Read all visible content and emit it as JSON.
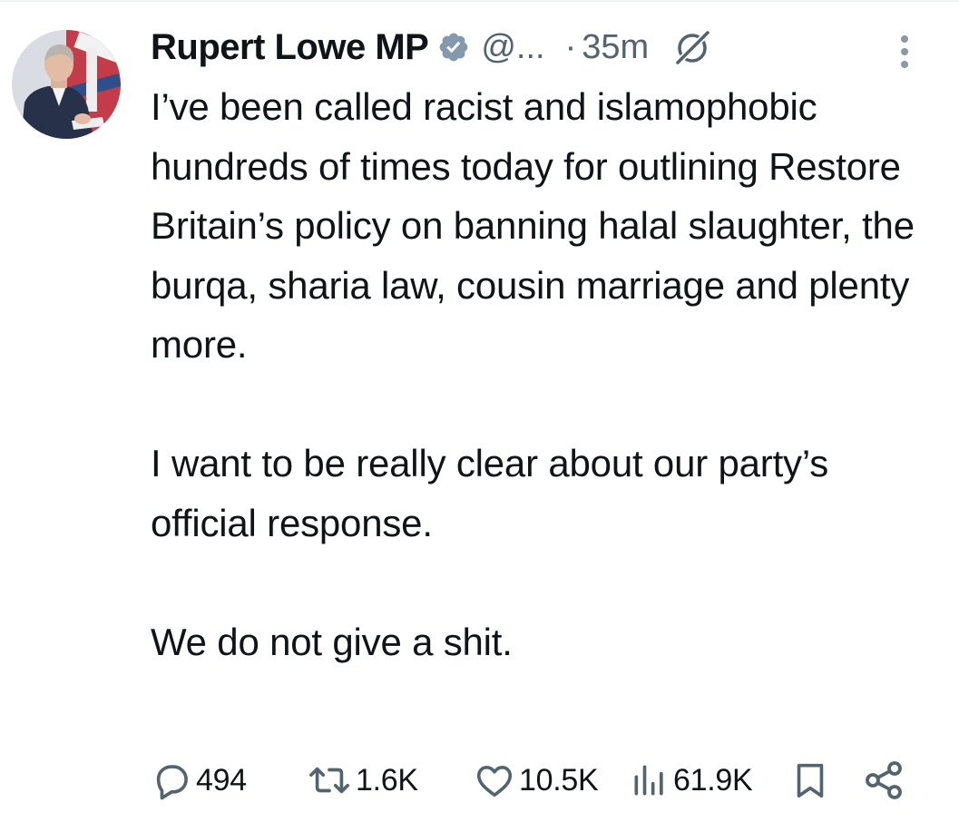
{
  "tweet": {
    "author": {
      "display_name": "Rupert Lowe MP",
      "handle": "@...",
      "verified_icon": "verified-badge-icon"
    },
    "separator": "·",
    "time": "35m",
    "body": [
      "I’ve been called racist and islamophobic hundreds of times today for outlining Restore Britain’s policy on banning halal slaughter, the burqa, sharia law, cousin marriage and plenty more.",
      "I want to be really clear about our party’s official response.",
      "We do not give a shit."
    ],
    "metrics": {
      "replies": "494",
      "reposts": "1.6K",
      "likes": "10.5K",
      "views": "61.9K"
    },
    "icons": [
      "reply-icon",
      "repost-icon",
      "like-icon",
      "views-icon",
      "bookmark-icon",
      "share-icon",
      "grok-icon",
      "more-icon"
    ],
    "colors": {
      "text": "#0f1419",
      "secondary": "#536471",
      "badge": "#829aab"
    }
  }
}
